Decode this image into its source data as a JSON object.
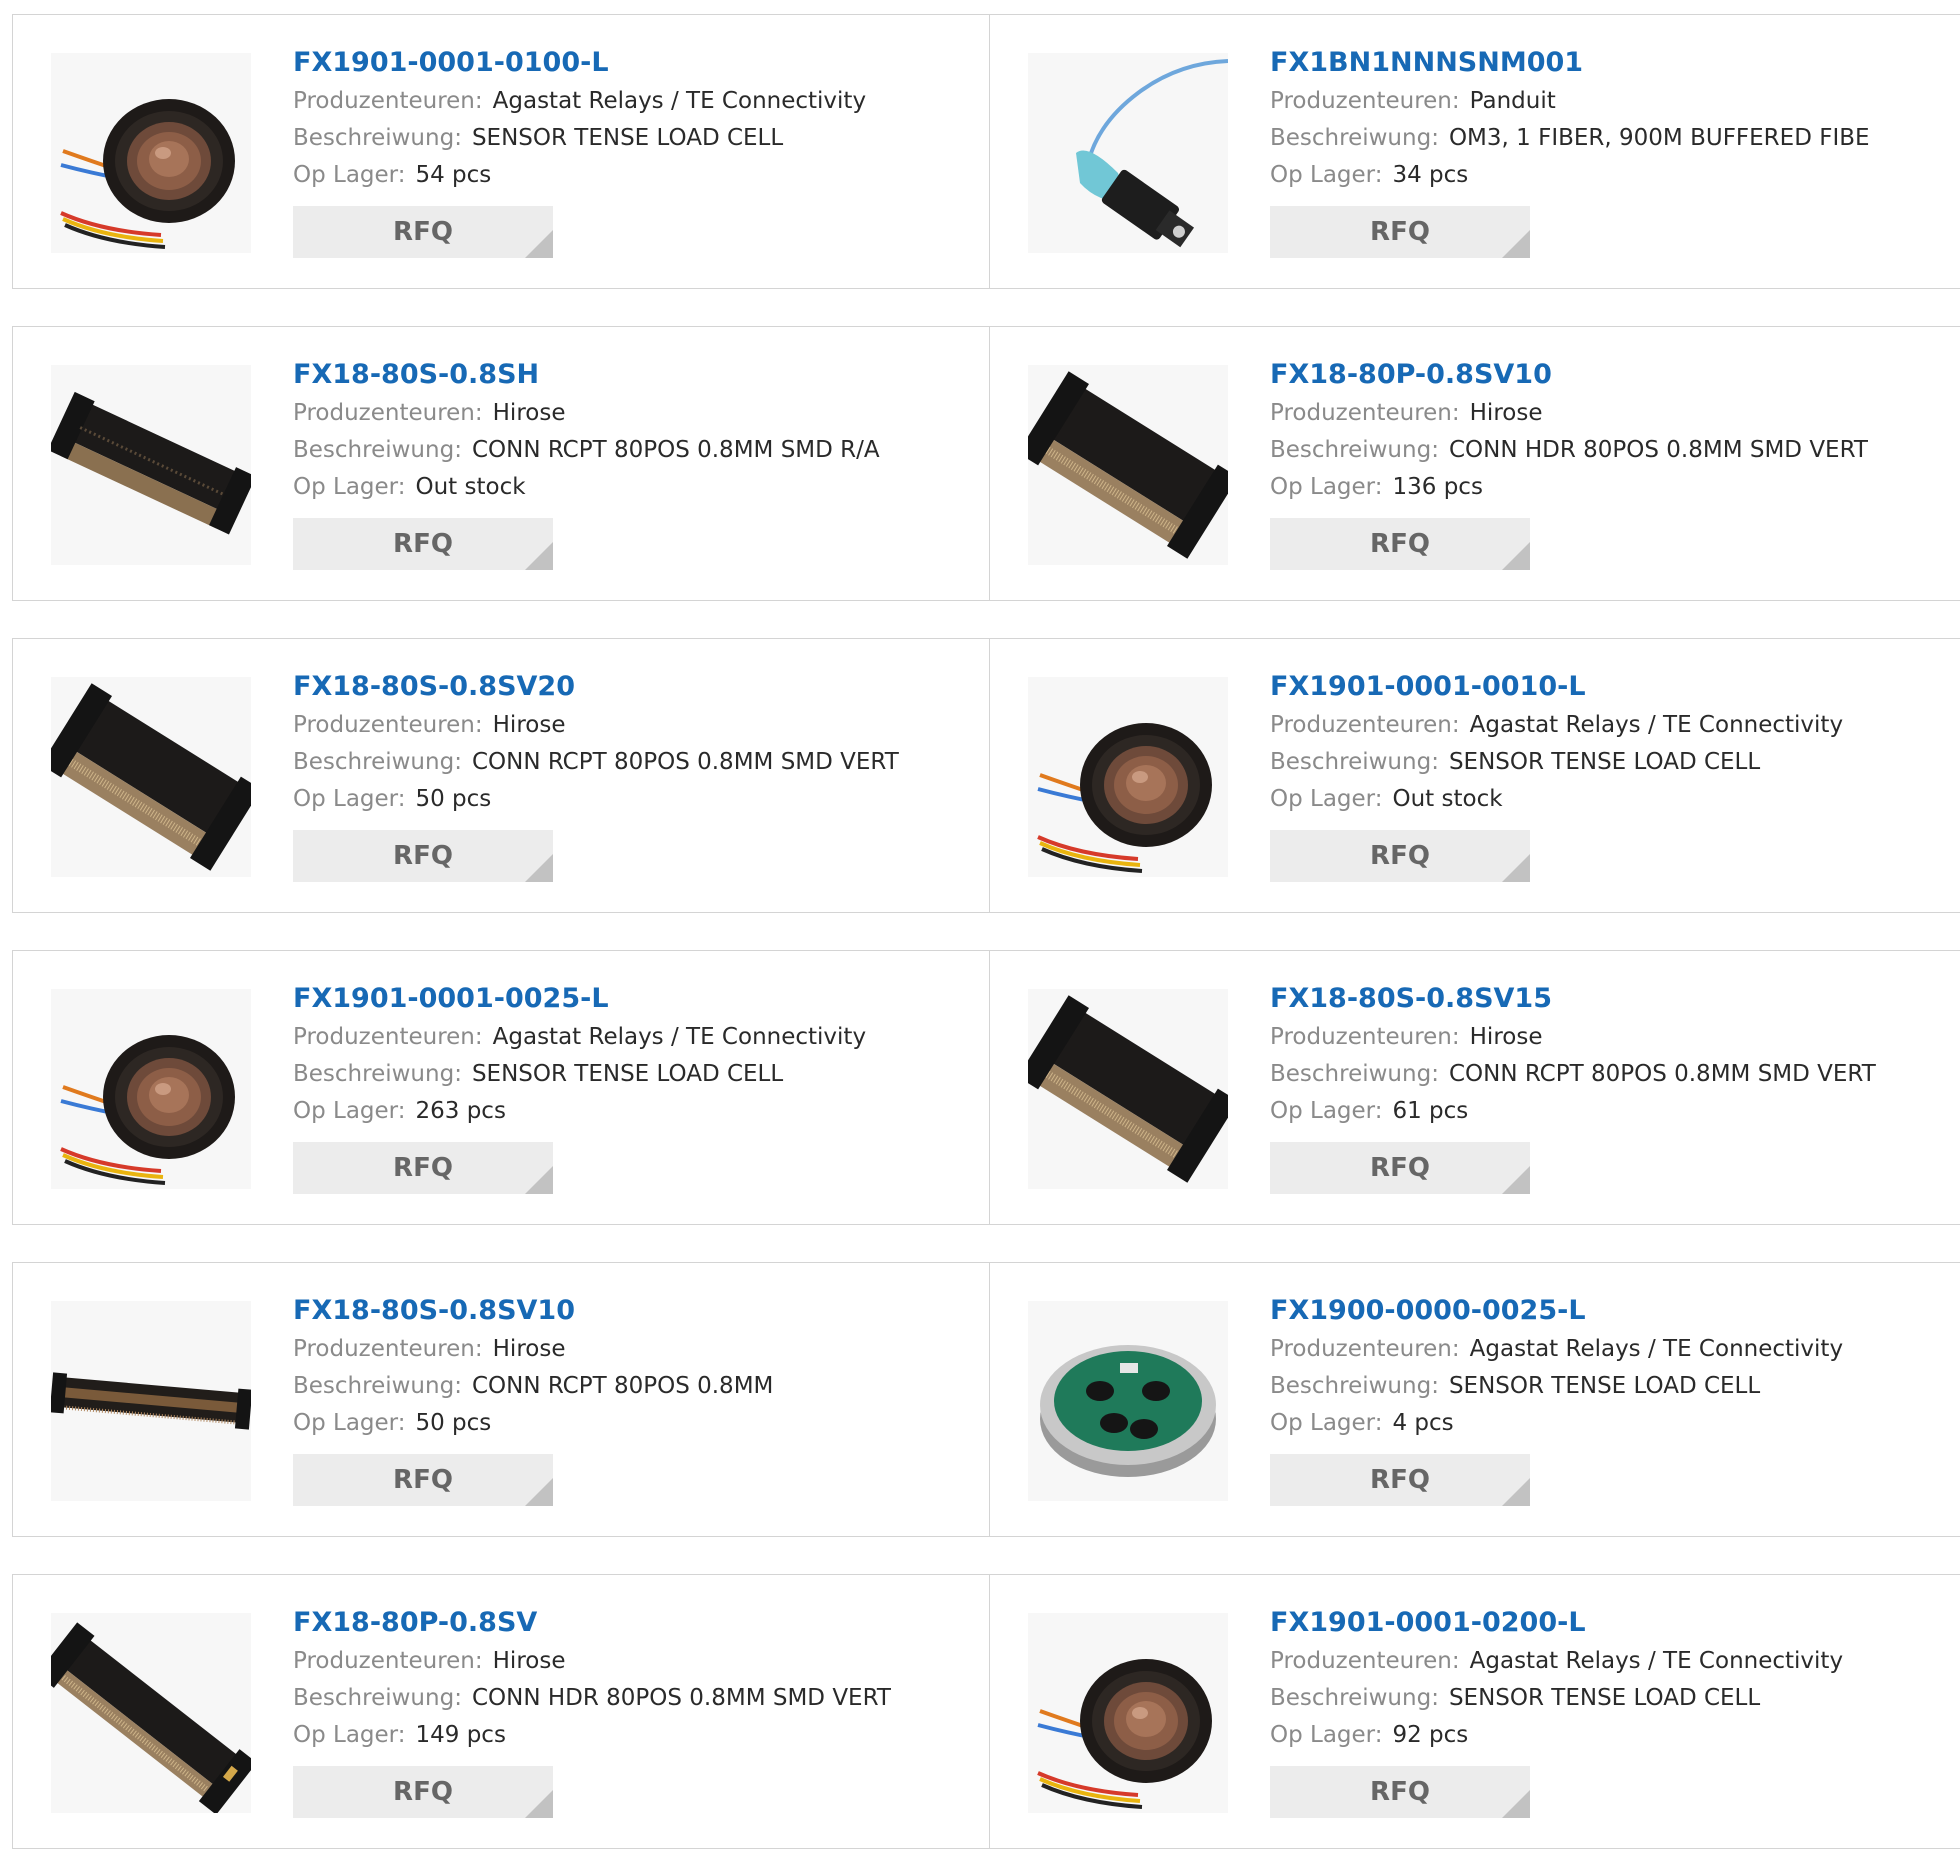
{
  "labels": {
    "manufacturer": "Produzenteuren:",
    "description": "Beschreiwung:",
    "stock": "Op Lager:"
  },
  "rfq_label": "RFQ",
  "colors": {
    "part_link": "#1769b5",
    "label": "#8a8a8a",
    "value": "#2a2a2a",
    "button_bg": "#ececec",
    "button_text": "#666666",
    "border": "#d4d4d4"
  },
  "products": [
    {
      "part": "FX1901-0001-0100-L",
      "manufacturer": "Agastat Relays / TE Connectivity",
      "description": "SENSOR TENSE LOAD CELL",
      "stock": "54 pcs",
      "image": "load-cell"
    },
    {
      "part": "FX1BN1NNNSNM001",
      "manufacturer": "Panduit",
      "description": "OM3, 1 FIBER, 900M BUFFERED FIBE",
      "stock": "34 pcs",
      "image": "fiber-connector"
    },
    {
      "part": "FX18-80S-0.8SH",
      "manufacturer": "Hirose",
      "description": "CONN RCPT 80POS 0.8MM SMD R/A",
      "stock": "Out stock",
      "image": "connector-ra"
    },
    {
      "part": "FX18-80P-0.8SV10",
      "manufacturer": "Hirose",
      "description": "CONN HDR 80POS 0.8MM SMD VERT",
      "stock": "136 pcs",
      "image": "connector-vert"
    },
    {
      "part": "FX18-80S-0.8SV20",
      "manufacturer": "Hirose",
      "description": "CONN RCPT 80POS 0.8MM SMD VERT",
      "stock": "50 pcs",
      "image": "connector-vert"
    },
    {
      "part": "FX1901-0001-0010-L",
      "manufacturer": "Agastat Relays / TE Connectivity",
      "description": "SENSOR TENSE LOAD CELL",
      "stock": "Out stock",
      "image": "load-cell"
    },
    {
      "part": "FX1901-0001-0025-L",
      "manufacturer": "Agastat Relays / TE Connectivity",
      "description": "SENSOR TENSE LOAD CELL",
      "stock": "263 pcs",
      "image": "load-cell"
    },
    {
      "part": "FX18-80S-0.8SV15",
      "manufacturer": "Hirose",
      "description": "CONN RCPT 80POS 0.8MM SMD VERT",
      "stock": "61 pcs",
      "image": "connector-vert"
    },
    {
      "part": "FX18-80S-0.8SV10",
      "manufacturer": "Hirose",
      "description": "CONN RCPT 80POS 0.8MM",
      "stock": "50 pcs",
      "image": "connector-flat"
    },
    {
      "part": "FX1900-0000-0025-L",
      "manufacturer": "Agastat Relays / TE Connectivity",
      "description": "SENSOR TENSE LOAD CELL",
      "stock": "4 pcs",
      "image": "load-cell-disc"
    },
    {
      "part": "FX18-80P-0.8SV",
      "manufacturer": "Hirose",
      "description": "CONN HDR 80POS 0.8MM SMD VERT",
      "stock": "149 pcs",
      "image": "connector-diag"
    },
    {
      "part": "FX1901-0001-0200-L",
      "manufacturer": "Agastat Relays / TE Connectivity",
      "description": "SENSOR TENSE LOAD CELL",
      "stock": "92 pcs",
      "image": "load-cell"
    }
  ]
}
